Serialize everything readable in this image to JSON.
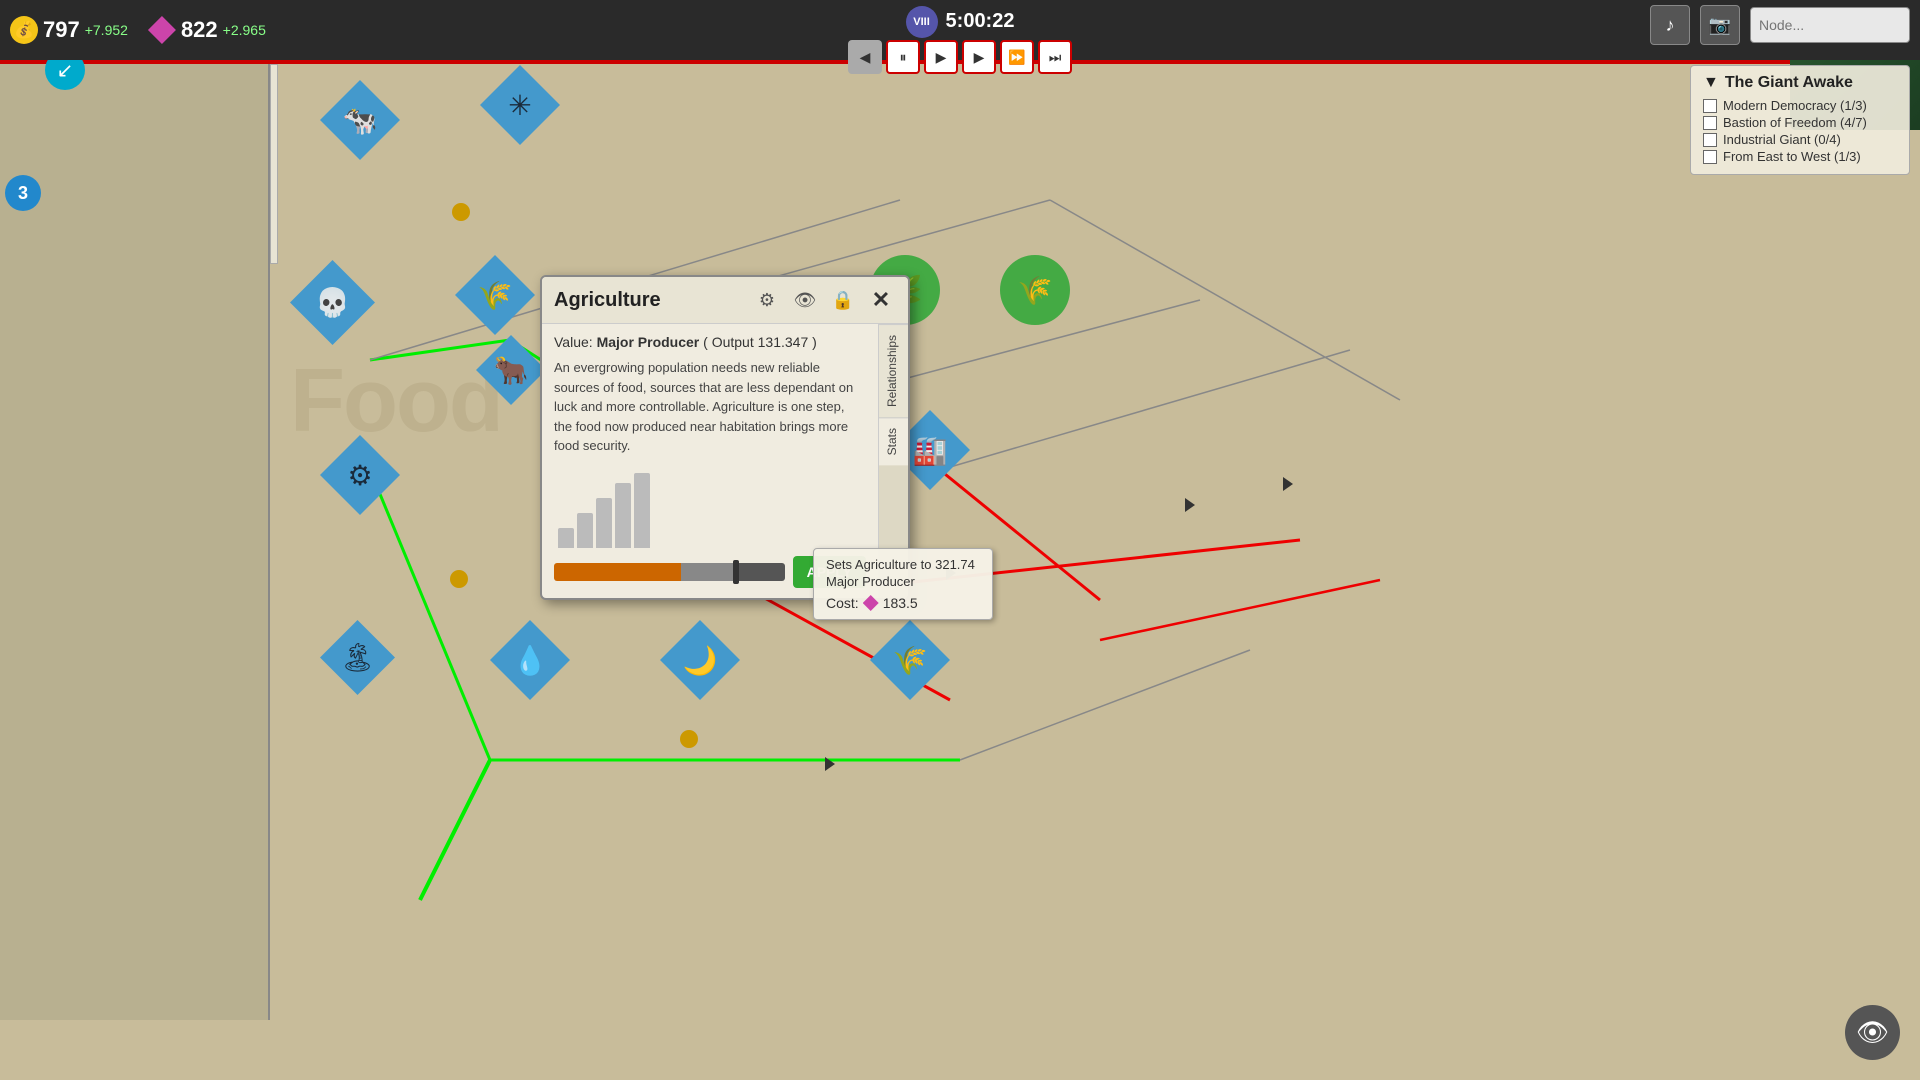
{
  "hud": {
    "gold": {
      "value": "797",
      "delta": "+7.952",
      "icon": "💰"
    },
    "gem": {
      "value": "822",
      "delta": "+2.965"
    },
    "player": {
      "badge": "VIII",
      "timer": "5:00:22"
    },
    "controls": {
      "pause": "⏸",
      "play": "▶",
      "play2": "▶",
      "ff": "⏩",
      "fff": "⏭",
      "back": "◀"
    },
    "search_placeholder": "Node...",
    "music_icon": "♪",
    "camera_icon": "📷"
  },
  "mission": {
    "title": "The Giant Awake",
    "triangle": "▼",
    "items": [
      {
        "label": "Modern Democracy (1/3)",
        "checked": false
      },
      {
        "label": "Bastion of Freedom (4/7)",
        "checked": false
      },
      {
        "label": "Industrial Giant (0/4)",
        "checked": false
      },
      {
        "label": "From East to West (1/3)",
        "checked": false
      }
    ]
  },
  "badges": {
    "num": "3",
    "arrow": "↙"
  },
  "dialog": {
    "title": "Agriculture",
    "icons": {
      "settings": "⚙",
      "eye": "👁",
      "lock": "🔒"
    },
    "close": "✕",
    "value_label": "Value:",
    "value_type": "Major Producer",
    "value_output": "( Output 131.347 )",
    "description": "An evergrowing population needs new reliable sources of food, sources that are less dependant on luck and more controllable. Agriculture is one step, the food now produced near habitation brings more food security.",
    "chart_bars": [
      20,
      35,
      55,
      75,
      90
    ],
    "apply_label": "APPLY",
    "side_tabs": [
      "Relationships",
      "Stats"
    ],
    "slider": {
      "orange_pct": 55,
      "gray_pct": 25,
      "dark_pct": 20
    }
  },
  "tooltip": {
    "line1": "Sets Agriculture to 321.74",
    "line2": "Major Producer",
    "cost_label": "Cost:",
    "cost_value": "183.5"
  },
  "eye_badge": "👁",
  "watermark": "Food"
}
